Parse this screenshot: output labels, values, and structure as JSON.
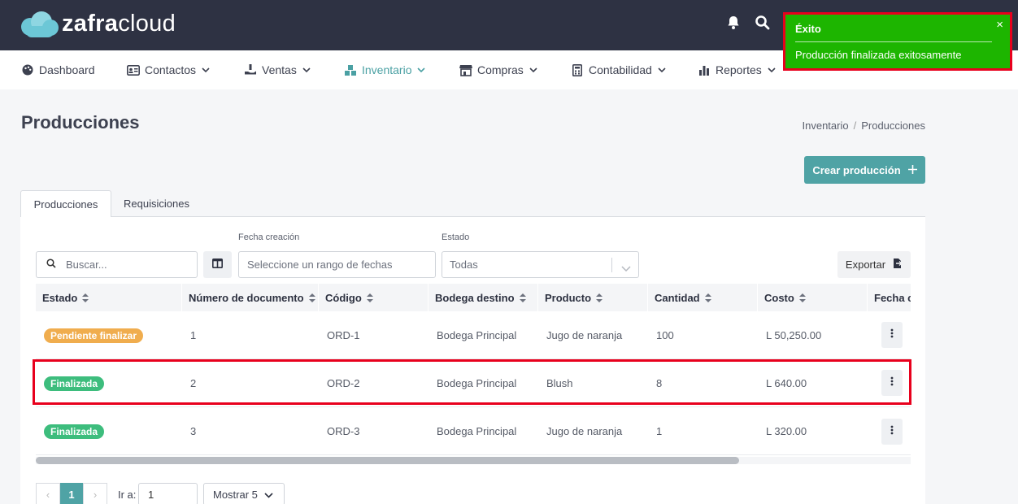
{
  "brand": {
    "name_bold": "zafra",
    "name_light": "cloud"
  },
  "nav": {
    "items": [
      {
        "label": "Dashboard",
        "icon": "palette-icon"
      },
      {
        "label": "Contactos",
        "icon": "contact-card-icon"
      },
      {
        "label": "Ventas",
        "icon": "hand-money-icon"
      },
      {
        "label": "Inventario",
        "icon": "boxes-icon"
      },
      {
        "label": "Compras",
        "icon": "store-icon"
      },
      {
        "label": "Contabilidad",
        "icon": "calculator-icon"
      },
      {
        "label": "Reportes",
        "icon": "bar-chart-icon"
      }
    ],
    "active": "Inventario"
  },
  "toast": {
    "title": "Éxito",
    "message": "Producción finalizada exitosamente",
    "close": "×"
  },
  "page": {
    "title": "Producciones",
    "breadcrumb": [
      "Inventario",
      "/",
      "Producciones"
    ],
    "create_button": "Crear producción"
  },
  "tabs": [
    "Producciones",
    "Requisiciones"
  ],
  "filters": {
    "search_placeholder": "Buscar...",
    "date_label": "Fecha creación",
    "date_placeholder": "Seleccione un rango de fechas",
    "state_label": "Estado",
    "state_value": "Todas",
    "export_label": "Exportar"
  },
  "table": {
    "columns": [
      "Estado",
      "Número de documento",
      "Código",
      "Bodega destino",
      "Producto",
      "Cantidad",
      "Costo",
      "Fecha c"
    ],
    "rows": [
      {
        "estado": "Pendiente finalizar",
        "numero": "1",
        "codigo": "ORD-1",
        "bodega": "Bodega Principal",
        "producto": "Jugo de naranja",
        "cantidad": "100",
        "costo": "L 50,250.00"
      },
      {
        "estado": "Finalizada",
        "numero": "2",
        "codigo": "ORD-2",
        "bodega": "Bodega Principal",
        "producto": "Blush",
        "cantidad": "8",
        "costo": "L 640.00"
      },
      {
        "estado": "Finalizada",
        "numero": "3",
        "codigo": "ORD-3",
        "bodega": "Bodega Principal",
        "producto": "Jugo de naranja",
        "cantidad": "1",
        "costo": "L 320.00"
      }
    ],
    "status_colors": {
      "Pendiente finalizar": "#f0ad4e",
      "Finalizada": "#3dbd7d"
    }
  },
  "pagination": {
    "prev": "‹",
    "current": "1",
    "next": "›",
    "goto_label": "Ir a:",
    "goto_value": "1",
    "page_size": "Mostrar 5"
  },
  "colors": {
    "topbar": "#2e3243",
    "accent": "#4fa3a5",
    "toast": "#1db500",
    "highlight": "#e8001d"
  }
}
